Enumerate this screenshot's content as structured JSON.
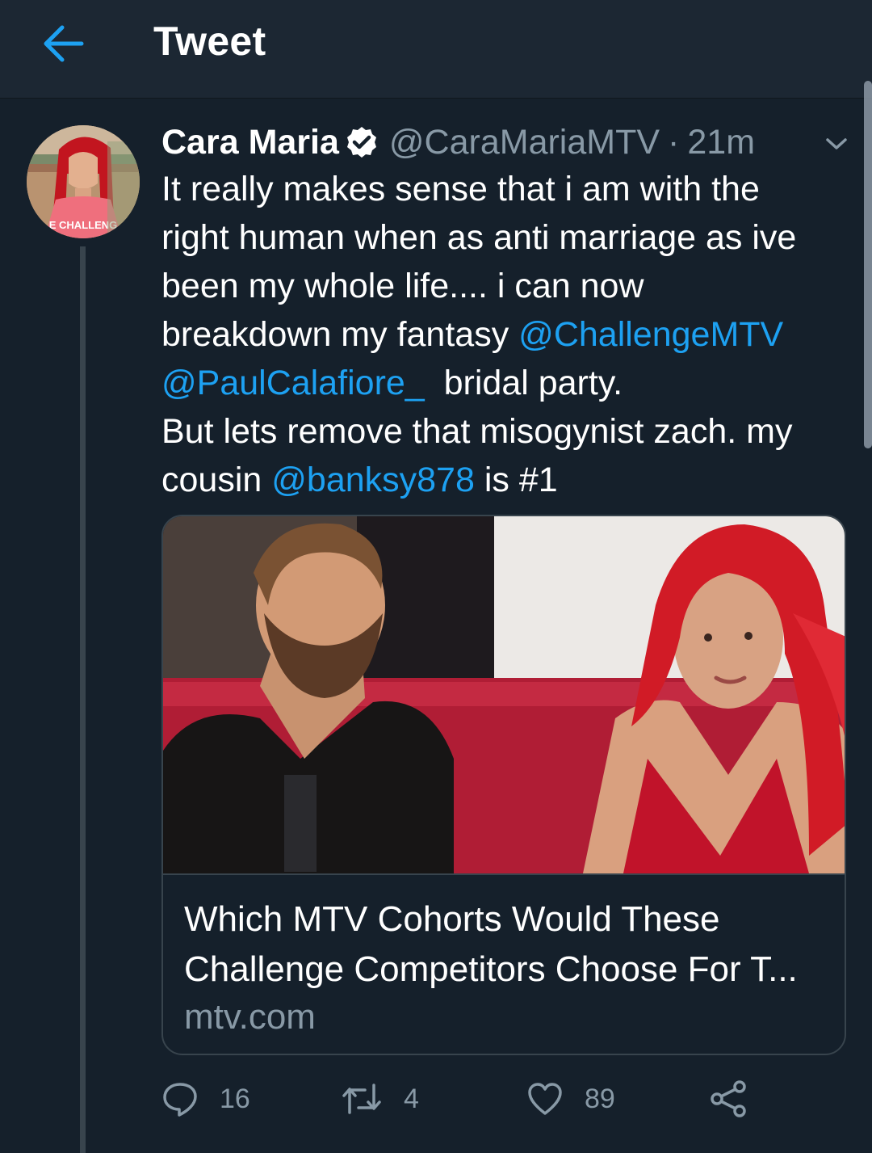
{
  "header": {
    "title": "Tweet",
    "back_icon": "arrow-left-icon"
  },
  "colors": {
    "background": "#15202b",
    "header_background": "#1c2733",
    "accent": "#1da1f2",
    "secondary_text": "#8899a6",
    "border": "#38444d"
  },
  "tweet": {
    "author": {
      "display_name": "Cara Maria",
      "handle": "@CaraMariaMTV",
      "verified": true,
      "avatar_text": "E CHALLENG"
    },
    "separator": "·",
    "time": "21m",
    "text_lines": [
      [
        {
          "text": "It really makes sense that i am with the"
        }
      ],
      [
        {
          "text": "right human when as anti marriage as ive"
        }
      ],
      [
        {
          "text": "been my whole life.... i can now"
        }
      ],
      [
        {
          "text": "breakdown my fantasy "
        },
        {
          "text": "@ChallengeMTV",
          "mention": true
        }
      ],
      [
        {
          "text": "@PaulCalafiore_",
          "mention": true
        },
        {
          "text": "  bridal party."
        }
      ],
      [
        {
          "text": "But lets remove that misogynist zach. my"
        }
      ],
      [
        {
          "text": "cousin "
        },
        {
          "text": "@banksy878",
          "mention": true
        },
        {
          "text": " is #1"
        }
      ]
    ],
    "card": {
      "title_lines": [
        "Which MTV Cohorts Would These",
        "Challenge Competitors Choose For T..."
      ],
      "domain": "mtv.com"
    },
    "actions": {
      "replies": "16",
      "retweets": "4",
      "likes": "89",
      "icons": [
        "reply-icon",
        "retweet-icon",
        "heart-icon",
        "share-icon"
      ]
    }
  }
}
